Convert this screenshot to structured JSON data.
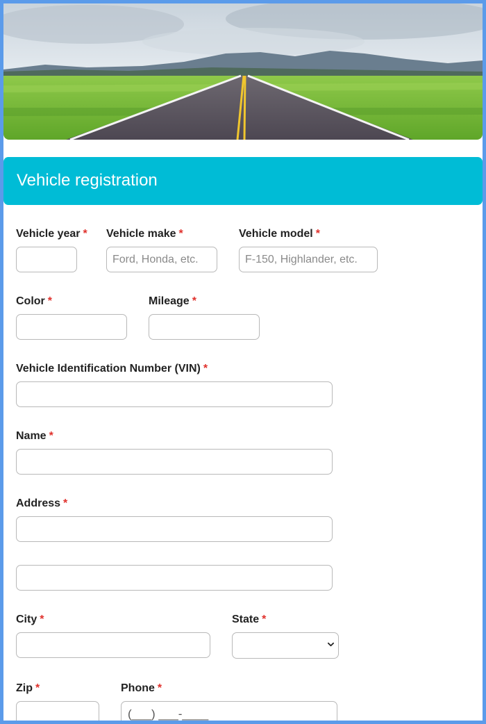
{
  "form": {
    "title": "Vehicle registration",
    "required_marker": "*",
    "fields": {
      "vehicle_year": {
        "label": "Vehicle year",
        "value": "",
        "placeholder": ""
      },
      "vehicle_make": {
        "label": "Vehicle make",
        "value": "",
        "placeholder": "Ford, Honda, etc."
      },
      "vehicle_model": {
        "label": "Vehicle model",
        "value": "",
        "placeholder": "F-150, Highlander, etc."
      },
      "color": {
        "label": "Color",
        "value": "",
        "placeholder": ""
      },
      "mileage": {
        "label": "Mileage",
        "value": "",
        "placeholder": ""
      },
      "vin": {
        "label": "Vehicle Identification Number (VIN)",
        "value": "",
        "placeholder": ""
      },
      "name": {
        "label": "Name",
        "value": "",
        "placeholder": ""
      },
      "address": {
        "label": "Address",
        "line1": "",
        "line2": ""
      },
      "city": {
        "label": "City",
        "value": "",
        "placeholder": ""
      },
      "state": {
        "label": "State",
        "selected": ""
      },
      "zip": {
        "label": "Zip",
        "value": "",
        "placeholder": ""
      },
      "phone": {
        "label": "Phone",
        "mask": "(___) ___-____"
      }
    }
  },
  "colors": {
    "page_border": "#5b9bea",
    "header_bar": "#00bcd6",
    "required": "#e0312c"
  }
}
